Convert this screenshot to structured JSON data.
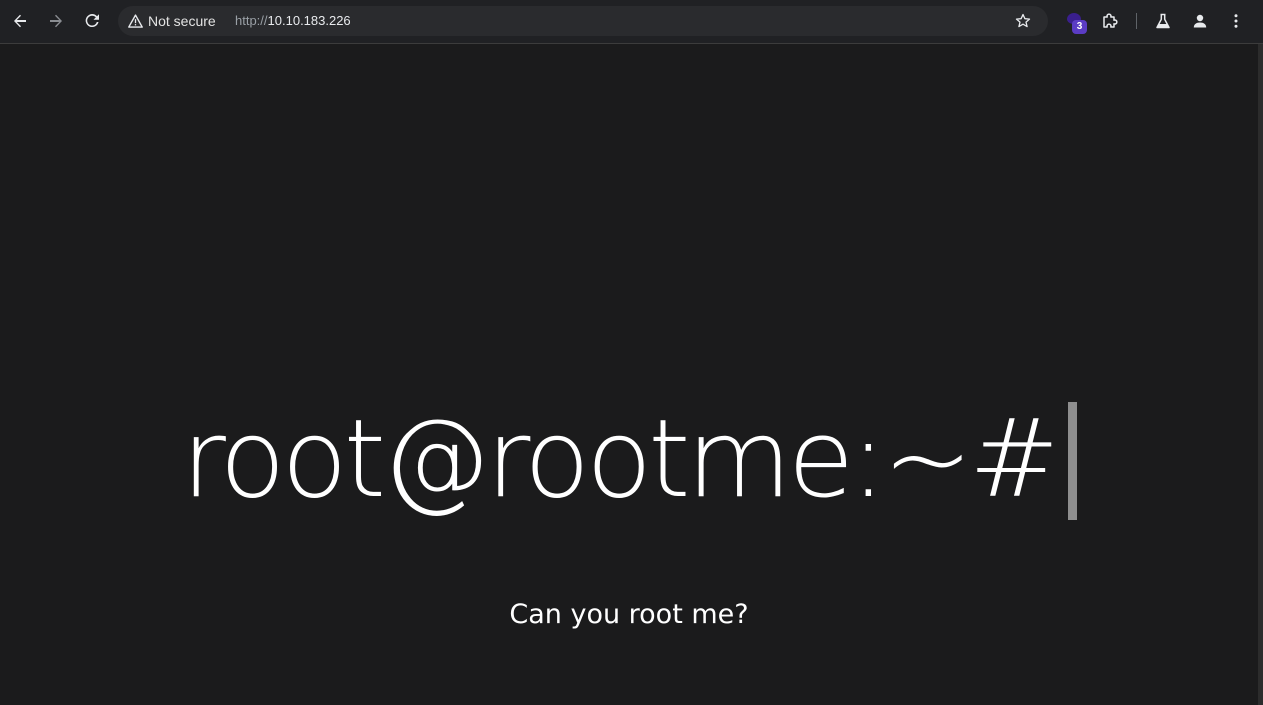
{
  "browser": {
    "security_label": "Not secure",
    "url_scheme": "http://",
    "url_host": "10.10.183.226",
    "extension_badge_count": "3",
    "icons": {
      "back": "arrow-left-icon",
      "forward": "arrow-right-icon",
      "reload": "reload-icon",
      "security": "warning-triangle-icon",
      "bookmark": "star-icon",
      "extension": "puzzle-icon",
      "labs": "flask-icon",
      "profile": "person-icon",
      "menu": "kebab-menu-icon"
    },
    "colors": {
      "toolbar": "#202124",
      "omnibox": "#2a2b2e",
      "badge": "#5b3cc4"
    }
  },
  "page": {
    "prompt_text": "root@rootme:~#",
    "subtitle": "Can you root me?",
    "colors": {
      "background": "#1b1b1c",
      "text": "#ffffff",
      "cursor": "#8e8e8e"
    }
  }
}
